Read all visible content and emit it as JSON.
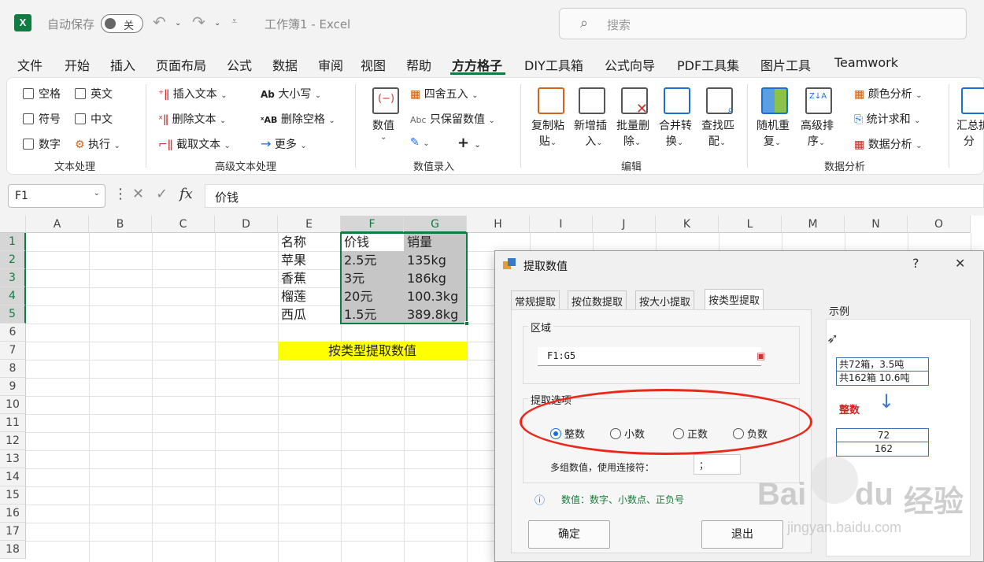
{
  "titlebar": {
    "autosave_label": "自动保存",
    "autosave_state": "关",
    "doc_title": "工作簿1  -  Excel",
    "search_placeholder": "搜索"
  },
  "menu": [
    "文件",
    "开始",
    "插入",
    "页面布局",
    "公式",
    "数据",
    "审阅",
    "视图",
    "帮助",
    "方方格子",
    "DIY工具箱",
    "公式向导",
    "PDF工具集",
    "图片工具",
    "Teamwork"
  ],
  "menu_active": "方方格子",
  "ribbon": {
    "text_group": {
      "checks": [
        "空格",
        "英文",
        "符号",
        "中文",
        "数字"
      ],
      "execute": "执行",
      "label": "文本处理"
    },
    "adv_text_group": {
      "insert": "插入文本",
      "delete": "删除文本",
      "cut": "截取文本",
      "case": "大小写",
      "del_space": "删除空格",
      "more": "更多",
      "label": "高级文本处理"
    },
    "num_group": {
      "value": "数值",
      "round": "四舍五入",
      "keep_num": "只保留数值",
      "label": "数值录入"
    },
    "edit_group": {
      "copy_paste": [
        "复制粘",
        "贴"
      ],
      "add_insert": [
        "新增插",
        "入"
      ],
      "batch_delete": [
        "批量删",
        "除"
      ],
      "merge_convert": [
        "合并转",
        "换"
      ],
      "find_match": [
        "查找匹",
        "配"
      ],
      "label": "编辑"
    },
    "analysis_group": {
      "random_repeat": [
        "随机重",
        "复"
      ],
      "adv_sort": [
        "高级排",
        "序"
      ],
      "color_analysis": "颜色分析",
      "stat_sum": "统计求和",
      "data_analysis": "数据分析",
      "label": "数据分析"
    },
    "summary_group": {
      "label_top": "汇总拆",
      "label_bottom": "分"
    }
  },
  "formula_bar": {
    "name_box": "F1",
    "fx": "fx",
    "content": "价钱"
  },
  "columns": [
    "A",
    "B",
    "C",
    "D",
    "E",
    "F",
    "G",
    "H",
    "I",
    "J",
    "K",
    "L",
    "M",
    "N",
    "O"
  ],
  "rows": [
    "1",
    "2",
    "3",
    "4",
    "5",
    "6",
    "7",
    "8",
    "9",
    "10",
    "11",
    "12",
    "13",
    "14",
    "15",
    "16",
    "17",
    "18"
  ],
  "table": [
    [
      "名称",
      "价钱",
      "销量"
    ],
    [
      "苹果",
      "2.5元",
      "135kg"
    ],
    [
      "香蕉",
      "3元",
      "186kg"
    ],
    [
      "榴莲",
      "20元",
      "100.3kg"
    ],
    [
      "西瓜",
      "1.5元",
      "389.8kg"
    ]
  ],
  "banner": "按类型提取数值",
  "dialog": {
    "title": "提取数值",
    "help": "?",
    "close": "✕",
    "tabs": [
      "常规提取",
      "按位数提取",
      "按大小提取",
      "按类型提取"
    ],
    "active_tab": "按类型提取",
    "area_label": "区域",
    "area_value": "F1:G5",
    "options_label": "提取选项",
    "radios": [
      "整数",
      "小数",
      "正数",
      "负数"
    ],
    "selected_radio": "整数",
    "joiner_label": "多组数值，使用连接符：",
    "joiner_value": "；",
    "info_text": "数值：数字、小数点、正负号",
    "ok": "确定",
    "exit": "退出",
    "example": {
      "label": "示例",
      "src": [
        "共72箱，3.5吨",
        "共162箱 10.6吨"
      ],
      "type_label": "整数",
      "result": [
        "72",
        "162"
      ]
    }
  },
  "watermark": {
    "brand": "Bai",
    "brand2": "du",
    "cn": "经验",
    "url": "jingyan.baidu.com"
  },
  "colors": {
    "excel_green": "#107c41",
    "highlight_yellow": "#ffff00",
    "annotation_red": "#e8291b",
    "radio_blue": "#1a6fd6"
  }
}
